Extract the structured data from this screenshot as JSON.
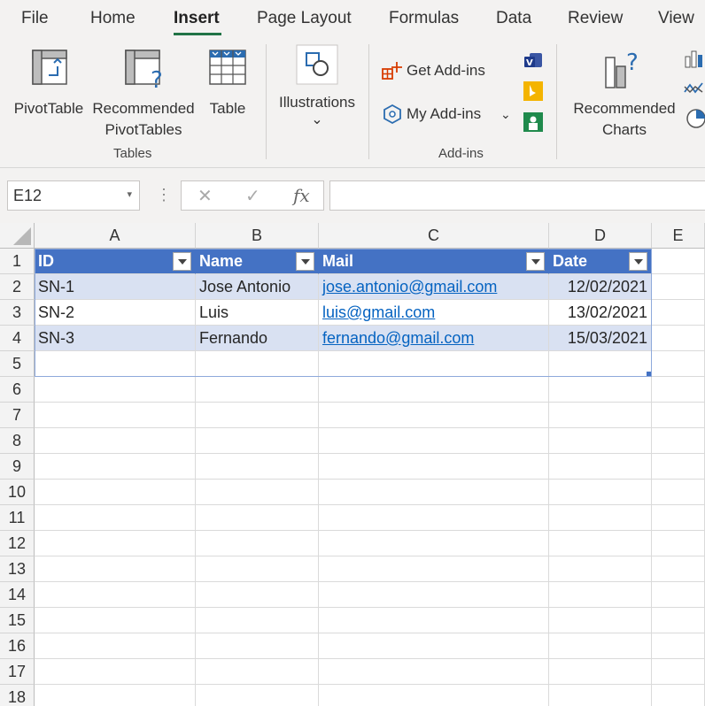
{
  "menu": {
    "tabs": [
      "File",
      "Home",
      "Insert",
      "Page Layout",
      "Formulas",
      "Data",
      "Review",
      "View"
    ],
    "active_tab": "Insert"
  },
  "ribbon": {
    "groups": {
      "tables": {
        "label": "Tables",
        "pivot_table": "PivotTable",
        "recommended_pivot_line1": "Recommended",
        "recommended_pivot_line2": "PivotTables",
        "table": "Table"
      },
      "illustrations": {
        "label": "Illustrations",
        "chevron": "⌄"
      },
      "addins": {
        "label": "Add-ins",
        "get_addins": "Get Add-ins",
        "my_addins": "My Add-ins",
        "my_addins_chevron": "⌄"
      },
      "charts": {
        "recommended_line1": "Recommended",
        "recommended_line2": "Charts"
      }
    },
    "colors": {
      "accent": "#217346",
      "icon_blue": "#2b6cb0",
      "icon_orange": "#d83b01"
    }
  },
  "formula_bar": {
    "name_box": "E12",
    "name_box_caret": "▾",
    "dots": "⋮",
    "cancel": "✕",
    "enter": "✓",
    "fx": "fx",
    "formula": ""
  },
  "sheet": {
    "columns": [
      "A",
      "B",
      "C",
      "D",
      "E"
    ],
    "rows": [
      "1",
      "2",
      "3",
      "4",
      "5",
      "6",
      "7",
      "8",
      "9",
      "10",
      "11",
      "12",
      "13",
      "14",
      "15",
      "16",
      "17",
      "18"
    ],
    "table": {
      "headers": [
        "ID",
        "Name",
        "Mail",
        "Date"
      ],
      "rows": [
        [
          "SN-1",
          "Jose Antonio",
          "jose.antonio@gmail.com",
          "12/02/2021"
        ],
        [
          "SN-2",
          "Luis",
          "luis@gmail.com",
          "13/02/2021"
        ],
        [
          "SN-3",
          "Fernando",
          "fernando@gmail.com",
          "15/03/2021"
        ]
      ],
      "header_color": "#4472c4",
      "band_color": "#d9e1f2",
      "link_color": "#0563c1"
    }
  }
}
